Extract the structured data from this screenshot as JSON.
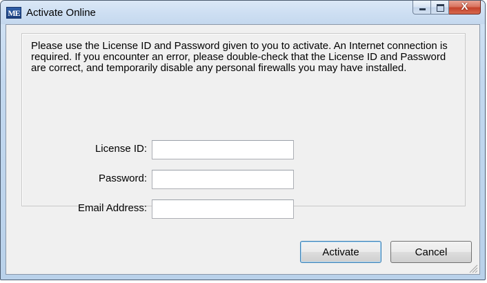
{
  "window": {
    "icon_text": "ME",
    "title": "Activate Online",
    "minimize_glyph": "",
    "maximize_glyph": "",
    "close_glyph": "X"
  },
  "instructions": "Please use the License ID and Password given to you to activate.  An Internet connection is required.  If you encounter an error, please double-check that the License ID and Password are correct, and temporarily disable any personal firewalls you may have installed.",
  "form": {
    "license_label": "License ID:",
    "license_value": "",
    "password_label": "Password:",
    "password_value": "",
    "email_label": "Email Address:",
    "email_value": ""
  },
  "buttons": {
    "activate": "Activate",
    "cancel": "Cancel"
  },
  "colors": {
    "title_bar": "#cfe0f3",
    "dialog_background": "#f0f0f0",
    "close_button": "#c4422b",
    "default_button_border": "#3c7fb1"
  }
}
